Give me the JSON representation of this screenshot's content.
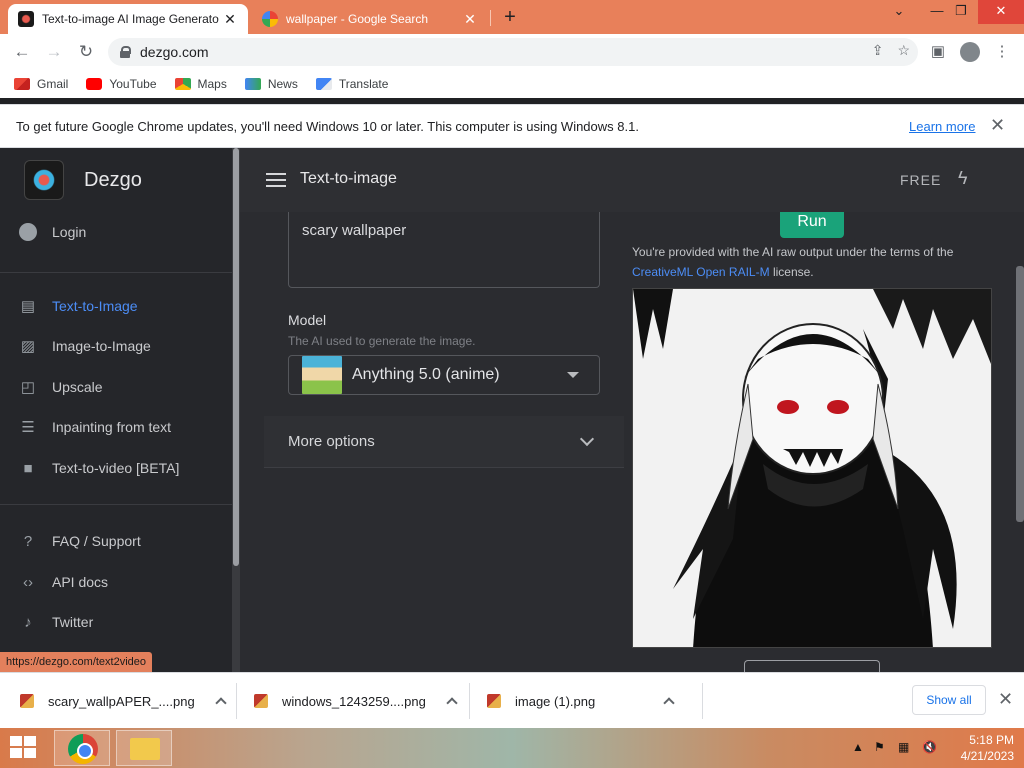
{
  "browser": {
    "tabs": [
      {
        "title": "Text-to-image AI Image Generato",
        "active": true
      },
      {
        "title": "wallpaper - Google Search",
        "active": false
      }
    ],
    "url": "dezgo.com",
    "bookmarks": [
      "Gmail",
      "YouTube",
      "Maps",
      "News",
      "Translate"
    ],
    "infobar": {
      "message": "To get future Google Chrome updates, you'll need Windows 10 or later. This computer is using Windows 8.1.",
      "link": "Learn more"
    },
    "status_url": "https://dezgo.com/text2video"
  },
  "sidebar": {
    "brand": "Dezgo",
    "login": "Login",
    "nav": [
      {
        "label": "Text-to-Image",
        "icon": "chat-icon",
        "active": true
      },
      {
        "label": "Image-to-Image",
        "icon": "image-icon",
        "active": false
      },
      {
        "label": "Upscale",
        "icon": "upscale-icon",
        "active": false
      },
      {
        "label": "Inpainting from text",
        "icon": "inpainting-icon",
        "active": false
      },
      {
        "label": "Text-to-video [BETA]",
        "icon": "video-icon",
        "active": false
      }
    ],
    "links": [
      {
        "label": "FAQ / Support",
        "icon": "question-icon"
      },
      {
        "label": "API docs",
        "icon": "code-icon"
      },
      {
        "label": "Twitter",
        "icon": "twitter-icon"
      }
    ]
  },
  "topbar": {
    "title": "Text-to-image",
    "plan": "FREE"
  },
  "form": {
    "prompt": "scary wallpaper",
    "model_label": "Model",
    "model_help": "The AI used to generate the image.",
    "model_value": "Anything 5.0 (anime)",
    "more_options": "More options"
  },
  "result": {
    "run_label": "Run",
    "license_pre": "You're provided with the AI raw output under the terms of the",
    "license_link": "CreativeML Open RAIL-M",
    "license_post": "license."
  },
  "downloads": {
    "items": [
      "scary_wallpAPER_....png",
      "windows_1243259....png",
      "image (1).png"
    ],
    "show_all": "Show all"
  },
  "taskbar": {
    "time": "5:18 PM",
    "date": "4/21/2023"
  },
  "colors": {
    "accent": "#4c8df6",
    "run": "#1aa37a",
    "chrome_frame": "#e8805a"
  }
}
